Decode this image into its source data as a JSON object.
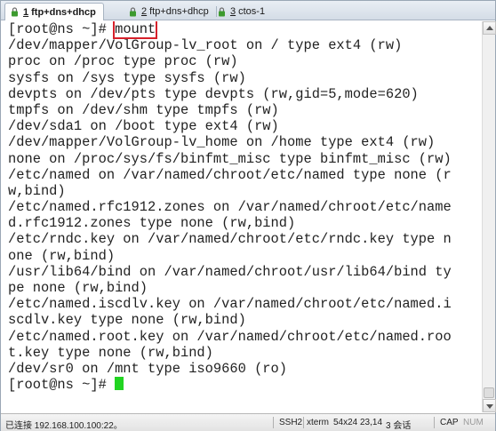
{
  "tabs": [
    {
      "number": "1",
      "label": "ftp+dns+dhcp",
      "active": true
    },
    {
      "number": "2",
      "label": "ftp+dns+dhcp",
      "active": false
    },
    {
      "number": "3",
      "label": "ctos-1",
      "active": false
    }
  ],
  "terminal": {
    "prompt": "[root@ns ~]# ",
    "command": "mount",
    "lines": [
      "/dev/mapper/VolGroup-lv_root on / type ext4 (rw)",
      "proc on /proc type proc (rw)",
      "sysfs on /sys type sysfs (rw)",
      "devpts on /dev/pts type devpts (rw,gid=5,mode=620)",
      "tmpfs on /dev/shm type tmpfs (rw)",
      "/dev/sda1 on /boot type ext4 (rw)",
      "/dev/mapper/VolGroup-lv_home on /home type ext4 (rw)",
      "none on /proc/sys/fs/binfmt_misc type binfmt_misc (rw)",
      "/etc/named on /var/named/chroot/etc/named type none (r",
      "w,bind)",
      "/etc/named.rfc1912.zones on /var/named/chroot/etc/name",
      "d.rfc1912.zones type none (rw,bind)",
      "/etc/rndc.key on /var/named/chroot/etc/rndc.key type n",
      "one (rw,bind)",
      "/usr/lib64/bind on /var/named/chroot/usr/lib64/bind ty",
      "pe none (rw,bind)",
      "/etc/named.iscdlv.key on /var/named/chroot/etc/named.i",
      "scdlv.key type none (rw,bind)",
      "/etc/named.root.key on /var/named/chroot/etc/named.roo",
      "t.key type none (rw,bind)",
      "/dev/sr0 on /mnt type iso9660 (ro)"
    ],
    "final_prompt": "[root@ns ~]# "
  },
  "statusbar": {
    "connection": "已连接 192.168.100.100:22。",
    "protocol": "SSH2",
    "terminal_type": "xterm",
    "size": "54x24",
    "cursor_pos": "23,14",
    "sessions": "3 会话",
    "cap": "CAP",
    "num": "NUM"
  },
  "colors": {
    "highlight_box": "#d6202a",
    "cursor": "#22d422",
    "text": "#222222"
  }
}
